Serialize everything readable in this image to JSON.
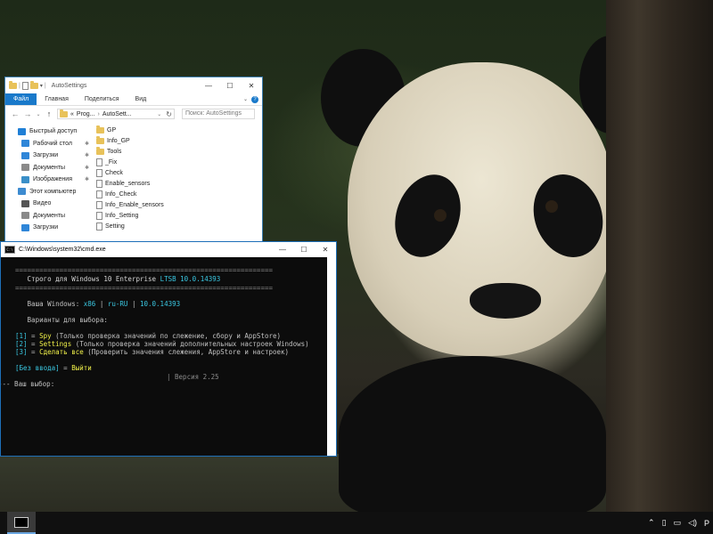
{
  "explorer": {
    "title": "AutoSettings",
    "ribbon_tabs": [
      "Файл",
      "Главная",
      "Поделиться",
      "Вид"
    ],
    "address_prefix": "«",
    "address_crumbs": [
      "Prog...",
      "AutoSett..."
    ],
    "search_placeholder": "Поиск: AutoSettings",
    "nav_items": [
      {
        "label": "Быстрый доступ",
        "icon": "star-icon",
        "color": "#1f7fd6",
        "level": 1,
        "pinned": false
      },
      {
        "label": "Рабочий стол",
        "icon": "desktop-icon",
        "color": "#2f86d8",
        "level": 2,
        "pinned": true
      },
      {
        "label": "Загрузки",
        "icon": "download-icon",
        "color": "#2f86d8",
        "level": 2,
        "pinned": true
      },
      {
        "label": "Документы",
        "icon": "documents-icon",
        "color": "#8a8a8a",
        "level": 2,
        "pinned": true
      },
      {
        "label": "Изображения",
        "icon": "pictures-icon",
        "color": "#3a8fc8",
        "level": 2,
        "pinned": true
      },
      {
        "label": "Этот компьютер",
        "icon": "computer-icon",
        "color": "#3d8bd0",
        "level": 1,
        "pinned": false
      },
      {
        "label": "Видео",
        "icon": "video-icon",
        "color": "#555555",
        "level": 2,
        "pinned": false
      },
      {
        "label": "Документы",
        "icon": "documents-icon",
        "color": "#8a8a8a",
        "level": 2,
        "pinned": false
      },
      {
        "label": "Загрузки",
        "icon": "download-icon",
        "color": "#2f86d8",
        "level": 2,
        "pinned": false
      }
    ],
    "files": [
      {
        "name": "GP",
        "type": "folder"
      },
      {
        "name": "Info_GP",
        "type": "folder"
      },
      {
        "name": "Tools",
        "type": "folder"
      },
      {
        "name": "_Fix",
        "type": "script"
      },
      {
        "name": "Check",
        "type": "script"
      },
      {
        "name": "Enable_sensors",
        "type": "script"
      },
      {
        "name": "Info_Check",
        "type": "script"
      },
      {
        "name": "Info_Enable_sensors",
        "type": "script"
      },
      {
        "name": "Info_Setting",
        "type": "script"
      },
      {
        "name": "Setting",
        "type": "script"
      }
    ]
  },
  "cmd": {
    "title": "C:\\Windows\\system32\\cmd.exe",
    "sep": "================================================================",
    "header_prefix": "   Строго для Windows 10 Enterprise ",
    "header_edition": "LTSB 10.0.14393",
    "your_windows_label": "   Ваша Windows: ",
    "arch": "x86",
    "pipe1": " | ",
    "lang": "ru-RU",
    "pipe2": " | ",
    "build": "10.0.14393",
    "options_title": "   Варианты для выбора:",
    "options": [
      {
        "key": "[1]",
        "eq": " = ",
        "name": "Spy",
        "desc": " (Только проверка значений по слежение, сбору и AppStore)"
      },
      {
        "key": "[2]",
        "eq": " = ",
        "name": "Settings",
        "desc": " (Только проверка значений дополнительных настроек Windows)"
      },
      {
        "key": "[3]",
        "eq": " = ",
        "name": "Сделать все",
        "desc": " (Проверить значения слежения, AppStore и настроек)"
      }
    ],
    "exit_key": "[Без ввода]",
    "exit_eq": " = ",
    "exit_label": "Выйти",
    "version": "| Версия 2.25",
    "prompt": "--- Ваш выбор:"
  },
  "taskbar": {
    "tray_letter": "P"
  },
  "colors": {
    "accent": "#1979ca",
    "console_cyan": "#3ac6e0",
    "console_yellow": "#f2f24a"
  }
}
